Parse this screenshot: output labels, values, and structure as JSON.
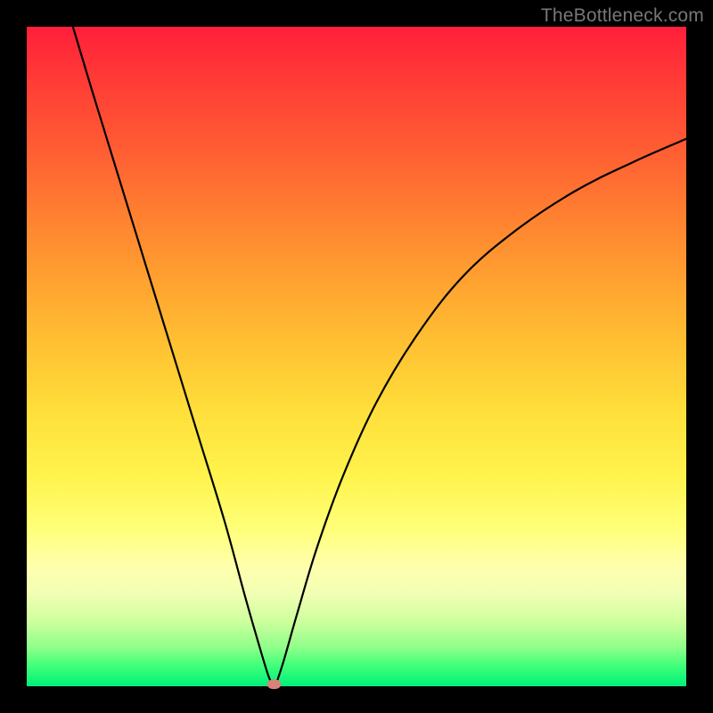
{
  "watermark": "TheBottleneck.com",
  "colors": {
    "page_bg": "#000000",
    "watermark_text": "#777777",
    "gradient_top": "#ff1f3a",
    "gradient_bottom": "#00f07a",
    "curve_stroke": "#000000",
    "marker_fill": "#d6837a"
  },
  "chart_data": {
    "type": "line",
    "title": "",
    "xlabel": "",
    "ylabel": "",
    "xlim": [
      0,
      100
    ],
    "ylim": [
      0,
      100
    ],
    "grid": false,
    "legend": "none",
    "notes": "V-shaped bottleneck curve on rainbow heat gradient. Y represents bottleneck severity (0 = green/no bottleneck at bottom, 100 = red/severe at top). Left branch is near-linear/steep; right branch is a decelerating convex rise. Minimum (optimal point) marked with a small rounded marker near x ≈ 37.",
    "series": [
      {
        "name": "left-branch",
        "x": [
          7,
          10,
          14,
          18,
          22,
          26,
          30,
          33,
          35,
          36.5,
          37.2
        ],
        "y": [
          100,
          90,
          77,
          64,
          51,
          38,
          25,
          14,
          7,
          2,
          0.3
        ]
      },
      {
        "name": "right-branch",
        "x": [
          37.8,
          39,
          41,
          44,
          48,
          53,
          59,
          66,
          74,
          83,
          92,
          100
        ],
        "y": [
          0.3,
          4,
          11,
          21,
          32,
          43,
          53,
          62,
          69,
          75,
          79.5,
          83
        ]
      }
    ],
    "marker": {
      "x": 37.5,
      "y": 0.3
    }
  }
}
